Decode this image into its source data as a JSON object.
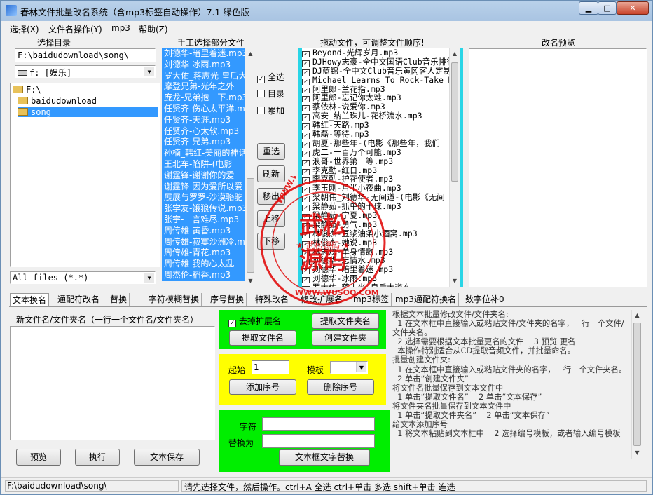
{
  "window": {
    "title": "春林文件批量改名系统（含mp3标签自动操作）7.1 绿色版",
    "min_label": "▁",
    "max_label": "□",
    "close_label": "✕"
  },
  "menu": [
    "选择(X)",
    "文件名操作(Y)",
    "mp3",
    "帮助(Z)"
  ],
  "left_panel": {
    "header": "选择目录",
    "path_value": "F:\\baidudownload\\song\\",
    "drive_value": "f: [娱乐]",
    "tree": [
      "F:\\",
      "baidudownload",
      "song"
    ],
    "filter_value": "All files (*.*)"
  },
  "select_panel": {
    "header": "手工选择部分文件",
    "items": [
      "刘德华-暗里着迷.mp3",
      "刘德华-冰雨.mp3",
      "罗大佑_蒋志光-皇后大道东",
      "摩登兄弟-光年之外",
      "庞龙-兄弟抱一下.mp3",
      "任贤齐-伤心太平洋.mp3",
      "任贤齐-天涯.mp3",
      "任贤齐-心太软.mp3",
      "任贤齐-兄弟.mp3",
      "孙楠_韩红-美丽的神话",
      "王北车-陷阱-(电影",
      "谢霆锋-谢谢你的爱",
      "谢霆锋-因为爱所以爱",
      "展展与罗罗-沙漠骆驼",
      "张学友-饿狼传说.mp3",
      "张宇-一言难尽.mp3",
      "周传雄-黄昏.mp3",
      "周传雄-寂寞沙洲冷.mp3",
      "周传雄-青花.mp3",
      "周传雄-我的心太乱",
      "周杰伦-稻香.mp3"
    ]
  },
  "middle_controls": {
    "checks": [
      {
        "label": "全选",
        "checked": true
      },
      {
        "label": "目录",
        "checked": false
      },
      {
        "label": "累加",
        "checked": false
      }
    ],
    "buttons": [
      "重选",
      "刷新",
      "移出",
      "上移",
      "下移"
    ]
  },
  "drag_panel": {
    "header": "拖动文件，可调整文件顺序!",
    "items": [
      "Beyond-光辉岁月.mp3",
      "DJHowy志豪-全中文国语Club音乐排行",
      "DJ蓝锦-全中文Club音乐黄冈客人定制",
      "Michael Learns To Rock-Take Me",
      "阿里郎-兰花指.mp3",
      "阿里郎-忘记你太难.mp3",
      "蔡依林-说爱你.mp3",
      "高安_纳兰珠儿-花桥流水.mp3",
      "韩红-天路.mp3",
      "韩磊-等待.mp3",
      "胡夏-那些年-(电影《那些年，我们",
      "虎二-一百万个可能.mp3",
      "浪哥-世界第一等.mp3",
      "李克勤-红日.mp3",
      "李克勤-护花使者.mp3",
      "李玉刚-月半小夜曲.mp3",
      "梁朝伟_刘德华-无间道-(电影《无间",
      "梁静茹-抓单的十球.mp3",
      "梁静茹-宁夏.mp3",
      "梁静茹-勇气.mp3",
      "林俊杰-豆浆油条小酒窝.mp3",
      "林俊杰-她说.mp3",
      "林志炫-单身情歌.mp3",
      "刘德华-忘情水.mp3",
      "刘德华-暗里着迷.mp3",
      "刘德华-冰雨.mp3",
      "罗大佑_蒋志光-皇后大道东"
    ]
  },
  "preview_panel": {
    "header": "改名预览"
  },
  "tabs": [
    "文本换名",
    "通配符改名",
    "替换",
    "字符模糊替换",
    "序号替换",
    "特殊改名",
    "修改扩展名",
    "mp3标签",
    "mp3通配符换名",
    "数字位补0"
  ],
  "text_rename": {
    "list_header": "新文件名/文件夹名（一行一个文件名/文件夹名）",
    "remove_ext_label": "去掉扩展名",
    "remove_ext_checked": true,
    "btn_extract_folder": "提取文件夹名",
    "btn_extract_file": "提取文件名",
    "btn_create_folder": "创建文件夹",
    "start_label": "起始",
    "start_value": "1",
    "template_label": "模板",
    "btn_add_seq": "添加序号",
    "btn_del_seq": "删除序号",
    "char_label": "字符",
    "replace_label": "替换为",
    "btn_text_replace": "文本框文字替换",
    "btn_preview": "预览",
    "btn_execute": "执行",
    "btn_save": "文本保存"
  },
  "help_text": "根据文本批量修改文件/文件夹名:\n  1 在文本框中直接输入或粘贴文件/文件夹的名字，一行一个文件/文件夹名。\n  2 选择需要根据文本批量更名的文件    3 预览 更名\n  本操作特别适合从CD提取音频文件，并批量命名。\n批量创建文件夹:\n  1 在文本框中直接输入或粘贴文件夹的名字，一行一个文件夹名。\n  2 单击“创建文件夹”\n将文件名批量保存到文本文件中\n  1 单击“提取文件名”    2 单击“文本保存”\n将文件夹名批量保存到文本文件中\n  1 单击“提取文件夹名”    2 单击“文本保存”\n给文本添加序号\n  1 将文本粘贴到文本框中    2 选择编号模板，或者输入编号模板",
  "status": {
    "path": "F:\\baidudownload\\song\\",
    "hint": "请先选择文件，然后操作。ctrl+A 全选 ctrl+单击 多选 shift+单击 连选"
  },
  "watermark": {
    "big1": "武松",
    "big2": "源码",
    "ring": "WWW.WUSOO.COM",
    "mid": "武松源码"
  },
  "colors": {
    "selection": "#3399ff",
    "cyan_border": "#29d5e6",
    "green_panel": "#00ee00",
    "yellow_panel": "#ffff00",
    "watermark_red": "#e00000"
  }
}
